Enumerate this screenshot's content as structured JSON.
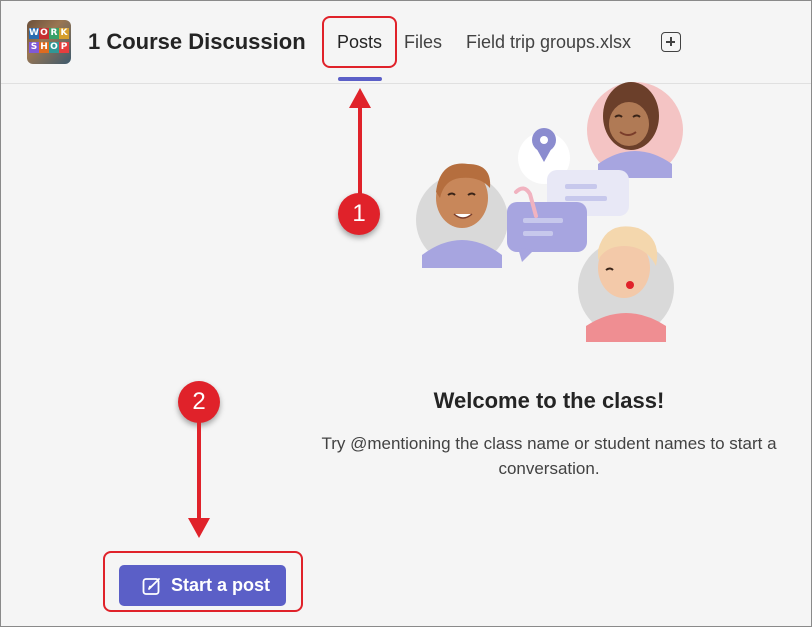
{
  "header": {
    "team_logo_text": "WORKSHOP",
    "team_title": "1 Course Discussion",
    "tabs": [
      {
        "label": "Posts",
        "active": true
      },
      {
        "label": "Files",
        "active": false
      },
      {
        "label": "Field trip groups.xlsx",
        "active": false
      }
    ],
    "add_tab_icon": "plus-square-icon"
  },
  "main": {
    "welcome_title": "Welcome to the class!",
    "welcome_body": "Try @mentioning the class name or student names to start a conversation.",
    "start_post_label": "Start a post",
    "start_post_icon": "compose-icon"
  },
  "annotations": {
    "callout_1": "1",
    "callout_2": "2"
  },
  "colors": {
    "accent": "#5b5fc7",
    "callout_red": "#e0222a",
    "background": "#f5f5f5"
  }
}
